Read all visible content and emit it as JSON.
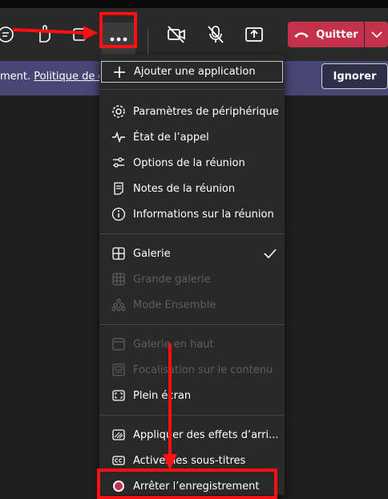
{
  "toolbar": {
    "quit_label": "Quitter",
    "icons": [
      "chat-icon",
      "reactions-icon",
      "rooms-icon",
      "more-options-icon",
      "camera-off-icon",
      "mic-off-icon",
      "share-icon",
      "hangup-icon",
      "chevron-down-icon"
    ]
  },
  "banner": {
    "text": "ment. ",
    "link": "Politique de co",
    "ignore_label": "Ignorer"
  },
  "menu": {
    "add_app": "Ajouter une application",
    "items": [
      {
        "label": "Paramètres de périphérique",
        "icon": "gear-icon",
        "enabled": true
      },
      {
        "label": "État de l’appel",
        "icon": "pulse-icon",
        "enabled": true
      },
      {
        "label": "Options de la réunion",
        "icon": "sliders-icon",
        "enabled": true
      },
      {
        "label": "Notes de la réunion",
        "icon": "notes-icon",
        "enabled": true
      },
      {
        "label": "Informations sur la réunion",
        "icon": "info-icon",
        "enabled": true
      },
      {
        "label": "Galerie",
        "icon": "gallery-icon",
        "enabled": true,
        "checked": true
      },
      {
        "label": "Grande galerie",
        "icon": "large-gallery-icon",
        "enabled": false
      },
      {
        "label": "Mode Ensemble",
        "icon": "together-mode-icon",
        "enabled": false
      },
      {
        "label": "Galerie en haut",
        "icon": "gallery-top-icon",
        "enabled": false
      },
      {
        "label": "Focalisation sur le contenu",
        "icon": "content-focus-icon",
        "enabled": false
      },
      {
        "label": "Plein écran",
        "icon": "fullscreen-icon",
        "enabled": true
      },
      {
        "label": "Appliquer des effets d’arri...",
        "icon": "background-effects-icon",
        "enabled": true
      },
      {
        "label": "Activer les sous-titres",
        "icon": "captions-icon",
        "enabled": true
      },
      {
        "label": "Arrêter l’enregistrement",
        "icon": "record-icon",
        "enabled": true
      }
    ]
  },
  "colors": {
    "accent_red": "#c4314b",
    "annotation_red": "#ff1010",
    "banner_bg": "#464775",
    "menu_bg": "#292929",
    "disabled_text": "#5e5e5e"
  }
}
